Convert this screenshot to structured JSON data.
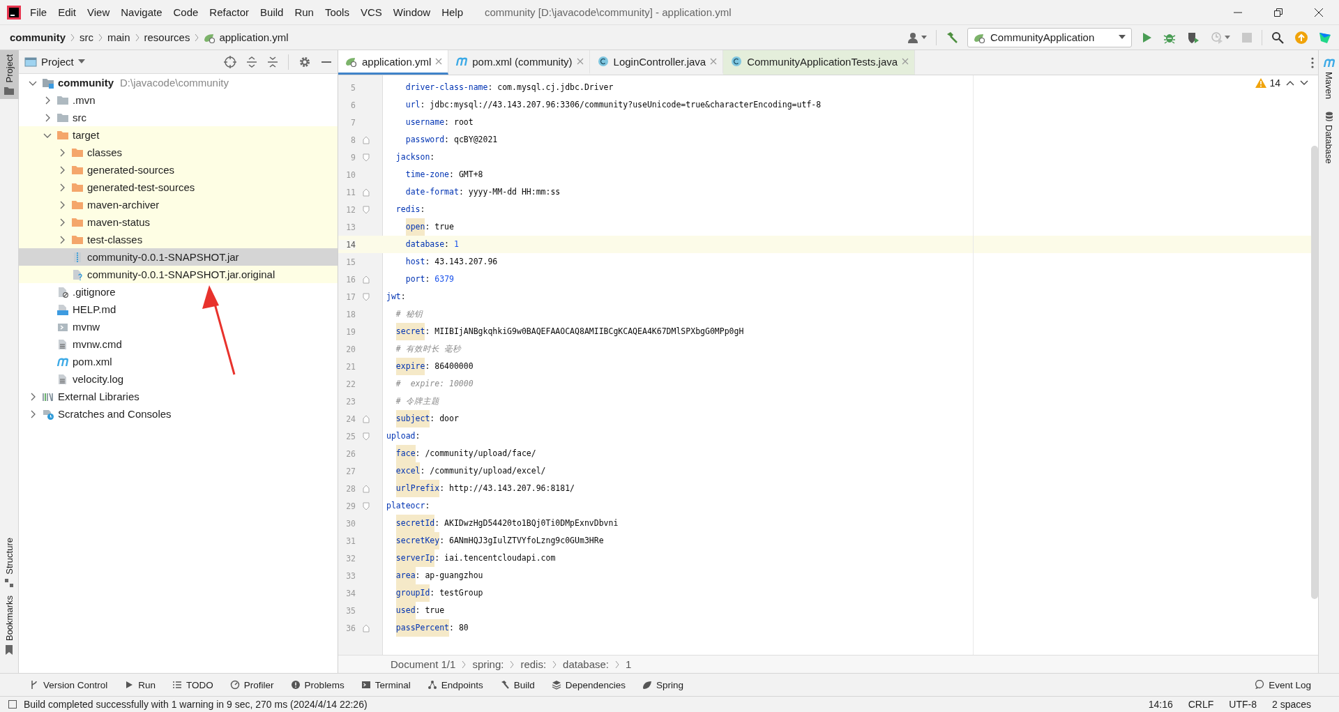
{
  "window": {
    "title": "community [D:\\javacode\\community] - application.yml"
  },
  "menu": [
    "File",
    "Edit",
    "View",
    "Navigate",
    "Code",
    "Refactor",
    "Build",
    "Run",
    "Tools",
    "VCS",
    "Window",
    "Help"
  ],
  "breadcrumbs": [
    {
      "label": "community",
      "kind": "project"
    },
    {
      "label": "src",
      "kind": "folder"
    },
    {
      "label": "main",
      "kind": "folder"
    },
    {
      "label": "resources",
      "kind": "folder"
    },
    {
      "label": "application.yml",
      "kind": "file"
    }
  ],
  "run_configuration": "CommunityApplication",
  "left_stripe": [
    {
      "label": "Project",
      "selected": true
    },
    {
      "label": "Structure",
      "selected": false
    },
    {
      "label": "Bookmarks",
      "selected": false
    }
  ],
  "right_stripe": [
    "Maven",
    "Database"
  ],
  "project_panel": {
    "title": "Project",
    "tree": [
      {
        "label": "community",
        "path": "D:\\javacode\\community",
        "kind": "module",
        "expanded": true,
        "selected": false,
        "excluded": false,
        "children": [
          {
            "label": ".mvn",
            "kind": "folder",
            "expanded": false,
            "selected": false,
            "excluded": false
          },
          {
            "label": "src",
            "kind": "folder",
            "expanded": false,
            "selected": false,
            "excluded": false
          },
          {
            "label": "target",
            "kind": "folder",
            "expanded": true,
            "selected": false,
            "excluded": true,
            "children": [
              {
                "label": "classes",
                "kind": "folder",
                "expanded": false,
                "selected": false
              },
              {
                "label": "generated-sources",
                "kind": "folder",
                "expanded": false,
                "selected": false
              },
              {
                "label": "generated-test-sources",
                "kind": "folder",
                "expanded": false,
                "selected": false
              },
              {
                "label": "maven-archiver",
                "kind": "folder",
                "expanded": false,
                "selected": false
              },
              {
                "label": "maven-status",
                "kind": "folder",
                "expanded": false,
                "selected": false
              },
              {
                "label": "test-classes",
                "kind": "folder",
                "expanded": false,
                "selected": false
              },
              {
                "label": "community-0.0.1-SNAPSHOT.jar",
                "kind": "archive",
                "selected": true
              },
              {
                "label": "community-0.0.1-SNAPSHOT.jar.original",
                "kind": "unknown",
                "selected": false
              }
            ]
          },
          {
            "label": ".gitignore",
            "kind": "ignore",
            "selected": false,
            "excluded": false
          },
          {
            "label": "HELP.md",
            "kind": "markdown",
            "selected": false,
            "excluded": false
          },
          {
            "label": "mvnw",
            "kind": "shell",
            "selected": false,
            "excluded": false
          },
          {
            "label": "mvnw.cmd",
            "kind": "text",
            "selected": false,
            "excluded": false
          },
          {
            "label": "pom.xml",
            "kind": "maven",
            "selected": false,
            "excluded": false
          },
          {
            "label": "velocity.log",
            "kind": "text",
            "selected": false,
            "excluded": false
          }
        ]
      },
      {
        "label": "External Libraries",
        "kind": "libraries",
        "expanded": false,
        "selected": false,
        "excluded": false
      },
      {
        "label": "Scratches and Consoles",
        "kind": "scratches",
        "expanded": false,
        "selected": false,
        "excluded": false
      }
    ]
  },
  "editor": {
    "tabs": [
      {
        "label": "application.yml",
        "kind": "yaml",
        "selected": true,
        "test": false
      },
      {
        "label": "pom.xml (community)",
        "kind": "maven",
        "selected": false,
        "test": false
      },
      {
        "label": "LoginController.java",
        "kind": "class",
        "selected": false,
        "test": false
      },
      {
        "label": "CommunityApplicationTests.java",
        "kind": "class",
        "selected": false,
        "test": true
      }
    ],
    "warning_count": "14",
    "lines": [
      {
        "children": [
          {
            "children": [
              {
                "number": "5",
                "current": false,
                "tokens": [
                  {
                    "kind": "key",
                    "text": "driver-class-name"
                  },
                  {
                    "kind": "plain",
                    "text": ": com.mysql.cj.jdbc.Driver"
                  }
                ]
              },
              {
                "number": "6",
                "current": false,
                "tokens": [
                  {
                    "kind": "key",
                    "text": "url"
                  },
                  {
                    "kind": "plain",
                    "text": ": jdbc:mysql://43.143.207.96:3306/community?useUnicode=true&characterEncoding=utf-8"
                  }
                ]
              },
              {
                "number": "7",
                "current": false,
                "tokens": [
                  {
                    "kind": "key",
                    "text": "username"
                  },
                  {
                    "kind": "plain",
                    "text": ": root"
                  }
                ]
              },
              {
                "number": "8",
                "current": false,
                "tokens": [
                  {
                    "kind": "key",
                    "text": "password"
                  },
                  {
                    "kind": "plain",
                    "text": ": qcBY@2021"
                  }
                ]
              }
            ]
          },
          {
            "number": "9",
            "current": false,
            "tokens": [
              {
                "kind": "key",
                "text": "jackson"
              },
              {
                "kind": "plain",
                "text": ":"
              }
            ],
            "children": [
              {
                "number": "10",
                "current": false,
                "tokens": [
                  {
                    "kind": "key",
                    "text": "time-zone"
                  },
                  {
                    "kind": "plain",
                    "text": ": GMT+8"
                  }
                ]
              },
              {
                "number": "11",
                "current": false,
                "tokens": [
                  {
                    "kind": "key",
                    "text": "date-format"
                  },
                  {
                    "kind": "plain",
                    "text": ": yyyy-MM-dd HH:mm:ss"
                  }
                ]
              }
            ]
          },
          {
            "number": "12",
            "current": false,
            "tokens": [
              {
                "kind": "key",
                "text": "redis"
              },
              {
                "kind": "plain",
                "text": ":"
              }
            ],
            "children": [
              {
                "number": "13",
                "current": false,
                "tokens": [
                  {
                    "kind": "flagged-key",
                    "text": "open"
                  },
                  {
                    "kind": "plain",
                    "text": ": true"
                  }
                ]
              },
              {
                "number": "14",
                "current": true,
                "tokens": [
                  {
                    "kind": "key",
                    "text": "database"
                  },
                  {
                    "kind": "plain",
                    "text": ": "
                  },
                  {
                    "kind": "number",
                    "text": "1"
                  }
                ]
              },
              {
                "number": "15",
                "current": false,
                "tokens": [
                  {
                    "kind": "key",
                    "text": "host"
                  },
                  {
                    "kind": "plain",
                    "text": ": 43.143.207.96"
                  }
                ]
              },
              {
                "number": "16",
                "current": false,
                "tokens": [
                  {
                    "kind": "key",
                    "text": "port"
                  },
                  {
                    "kind": "plain",
                    "text": ": "
                  },
                  {
                    "kind": "number",
                    "text": "6379"
                  }
                ]
              }
            ]
          }
        ]
      },
      {
        "number": "17",
        "current": false,
        "tokens": [
          {
            "kind": "key",
            "text": "jwt"
          },
          {
            "kind": "plain",
            "text": ":"
          }
        ],
        "children": [
          {
            "number": "18",
            "current": false,
            "tokens": [
              {
                "kind": "comment",
                "text": "# 秘钥"
              }
            ]
          },
          {
            "number": "19",
            "current": false,
            "tokens": [
              {
                "kind": "flagged-key",
                "text": "secret"
              },
              {
                "kind": "plain",
                "text": ": MIIBIjANBgkqhkiG9w0BAQEFAAOCAQ8AMIIBCgKCAQEA4K67DMlSPXbgG0MPp0gH"
              }
            ]
          },
          {
            "number": "20",
            "current": false,
            "tokens": [
              {
                "kind": "comment",
                "text": "# 有效时长 毫秒"
              }
            ]
          },
          {
            "number": "21",
            "current": false,
            "tokens": [
              {
                "kind": "flagged-key",
                "text": "expire"
              },
              {
                "kind": "plain",
                "text": ": 86400000"
              }
            ]
          },
          {
            "number": "22",
            "current": false,
            "tokens": [
              {
                "kind": "comment",
                "text": "#  expire: 10000"
              }
            ]
          },
          {
            "number": "23",
            "current": false,
            "tokens": [
              {
                "kind": "comment",
                "text": "# 令牌主题"
              }
            ]
          },
          {
            "number": "24",
            "current": false,
            "tokens": [
              {
                "kind": "flagged-key",
                "text": "subject"
              },
              {
                "kind": "plain",
                "text": ": door"
              }
            ]
          }
        ]
      },
      {
        "number": "25",
        "current": false,
        "tokens": [
          {
            "kind": "key",
            "text": "upload"
          },
          {
            "kind": "plain",
            "text": ":"
          }
        ],
        "children": [
          {
            "number": "26",
            "current": false,
            "tokens": [
              {
                "kind": "flagged-key",
                "text": "face"
              },
              {
                "kind": "plain",
                "text": ": /community/upload/face/"
              }
            ]
          },
          {
            "number": "27",
            "current": false,
            "tokens": [
              {
                "kind": "flagged-key",
                "text": "excel"
              },
              {
                "kind": "plain",
                "text": ": /community/upload/excel/"
              }
            ]
          },
          {
            "number": "28",
            "current": false,
            "tokens": [
              {
                "kind": "flagged-key",
                "text": "urlPrefix"
              },
              {
                "kind": "plain",
                "text": ": http://43.143.207.96:8181/"
              }
            ]
          }
        ]
      },
      {
        "number": "29",
        "current": false,
        "tokens": [
          {
            "kind": "key",
            "text": "plateocr"
          },
          {
            "kind": "plain",
            "text": ":"
          }
        ],
        "children": [
          {
            "number": "30",
            "current": false,
            "tokens": [
              {
                "kind": "flagged-key",
                "text": "secretId"
              },
              {
                "kind": "plain",
                "text": ": AKIDwzHgD54420to1BQj0Ti0DMpExnvDbvni"
              }
            ]
          },
          {
            "number": "31",
            "current": false,
            "tokens": [
              {
                "kind": "flagged-key",
                "text": "secretKey"
              },
              {
                "kind": "plain",
                "text": ": 6ANmHQJ3gIulZTVYfoLzng9c0GUm3HRe"
              }
            ]
          },
          {
            "number": "32",
            "current": false,
            "tokens": [
              {
                "kind": "flagged-key",
                "text": "serverIp"
              },
              {
                "kind": "plain",
                "text": ": iai.tencentcloudapi.com"
              }
            ]
          },
          {
            "number": "33",
            "current": false,
            "tokens": [
              {
                "kind": "flagged-key",
                "text": "area"
              },
              {
                "kind": "plain",
                "text": ": ap-guangzhou"
              }
            ]
          },
          {
            "number": "34",
            "current": false,
            "tokens": [
              {
                "kind": "flagged-key",
                "text": "groupId"
              },
              {
                "kind": "plain",
                "text": ": testGroup"
              }
            ]
          },
          {
            "number": "35",
            "current": false,
            "tokens": [
              {
                "kind": "flagged-key",
                "text": "used"
              },
              {
                "kind": "plain",
                "text": ": true"
              }
            ]
          },
          {
            "number": "36",
            "current": false,
            "tokens": [
              {
                "kind": "flagged-key",
                "text": "passPercent"
              },
              {
                "kind": "plain",
                "text": ": 80"
              }
            ]
          }
        ]
      }
    ],
    "breadcrumbs": [
      "Document 1/1",
      "spring:",
      "redis:",
      "database:",
      "1"
    ]
  },
  "tool_windows": [
    {
      "label": "Version Control",
      "kind": "branch"
    },
    {
      "label": "Run",
      "kind": "play"
    },
    {
      "label": "TODO",
      "kind": "list"
    },
    {
      "label": "Profiler",
      "kind": "profiler"
    },
    {
      "label": "Problems",
      "kind": "problems"
    },
    {
      "label": "Terminal",
      "kind": "terminal"
    },
    {
      "label": "Endpoints",
      "kind": "endpoints"
    },
    {
      "label": "Build",
      "kind": "hammer"
    },
    {
      "label": "Dependencies",
      "kind": "layers"
    },
    {
      "label": "Spring",
      "kind": "leaf"
    }
  ],
  "event_log": "Event Log",
  "status_bar": {
    "message": "Build completed successfully with 1 warning in 9 sec, 270 ms (2024/4/14 22:26)",
    "items": [
      "14:16",
      "CRLF",
      "UTF-8",
      "2 spaces"
    ]
  }
}
